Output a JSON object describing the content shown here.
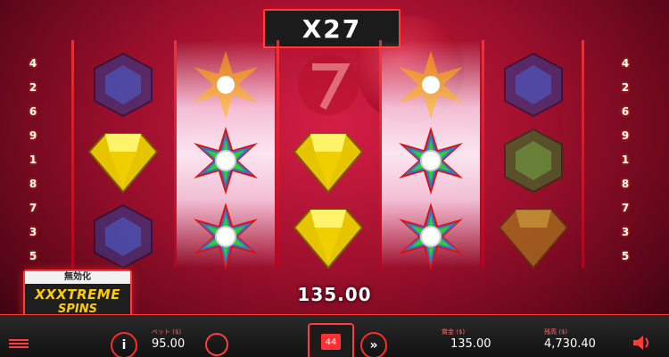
{
  "multiplier": {
    "text": "X27"
  },
  "win": {
    "amount": "135.00"
  },
  "left_paylines": [
    "4",
    "2",
    "6",
    "9",
    "1",
    "8",
    "7",
    "3",
    "5"
  ],
  "right_paylines": [
    "4",
    "2",
    "6",
    "9",
    "1",
    "8",
    "7",
    "3",
    "5"
  ],
  "feature_panel": {
    "header": "無効化",
    "line1": "XXXTREME",
    "line2": "SPINS"
  },
  "bottom_bar": {
    "bet_label": "ベット ($)",
    "bet_value": "95.00",
    "win_label": "賞金 ($)",
    "win_value": "135.00",
    "balance_label": "残高 ($)",
    "balance_value": "4,730.40",
    "spin_count": "44"
  },
  "reels": [
    [
      "blue-gem",
      "yellow-gem",
      "blue-gem"
    ],
    [
      "starburst-wild",
      "starburst-wild",
      "starburst-wild"
    ],
    [
      "seven",
      "yellow-gem",
      "yellow-gem"
    ],
    [
      "starburst-wild",
      "starburst-wild",
      "starburst-wild"
    ],
    [
      "blue-gem",
      "green-gem",
      "orange-gem"
    ]
  ],
  "colors": {
    "accent": "#ff3b3b",
    "background": "#9c0f2c",
    "gold": "#ffcc00"
  }
}
